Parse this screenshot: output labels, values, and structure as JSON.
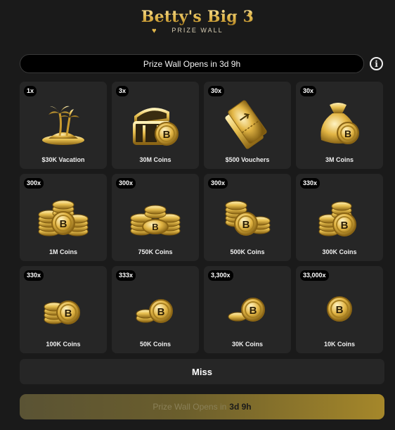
{
  "header": {
    "title": "Betty's Big 3",
    "subtitle": "PRIZE WALL"
  },
  "countdown": {
    "text": "Prize Wall Opens in 3d 9h"
  },
  "info": {
    "glyph": "i",
    "icon": "info-icon"
  },
  "prizes": [
    {
      "multiplier": "1x",
      "label": "$30K Vacation",
      "icon": "island-icon"
    },
    {
      "multiplier": "3x",
      "label": "30M Coins",
      "icon": "treasure-chest-icon"
    },
    {
      "multiplier": "30x",
      "label": "$500 Vouchers",
      "icon": "ticket-icon"
    },
    {
      "multiplier": "30x",
      "label": "3M Coins",
      "icon": "money-bag-icon"
    },
    {
      "multiplier": "300x",
      "label": "1M Coins",
      "icon": "coin-stack-large-icon"
    },
    {
      "multiplier": "300x",
      "label": "750K Coins",
      "icon": "coin-stack-icon"
    },
    {
      "multiplier": "300x",
      "label": "500K Coins",
      "icon": "coin-stack-icon"
    },
    {
      "multiplier": "330x",
      "label": "300K Coins",
      "icon": "coin-stack-icon"
    },
    {
      "multiplier": "330x",
      "label": "100K Coins",
      "icon": "coin-pile-icon"
    },
    {
      "multiplier": "333x",
      "label": "50K Coins",
      "icon": "coin-pile-icon"
    },
    {
      "multiplier": "3,300x",
      "label": "30K Coins",
      "icon": "coin-pair-icon"
    },
    {
      "multiplier": "33,000x",
      "label": "10K Coins",
      "icon": "coin-icon"
    }
  ],
  "miss": {
    "label": "Miss"
  },
  "cta": {
    "prefix": "Prize Wall Opens in",
    "time": "3d 9h"
  },
  "colors": {
    "gold": "#e0b64a",
    "tile": "#262626",
    "background": "#1a1a1a"
  }
}
